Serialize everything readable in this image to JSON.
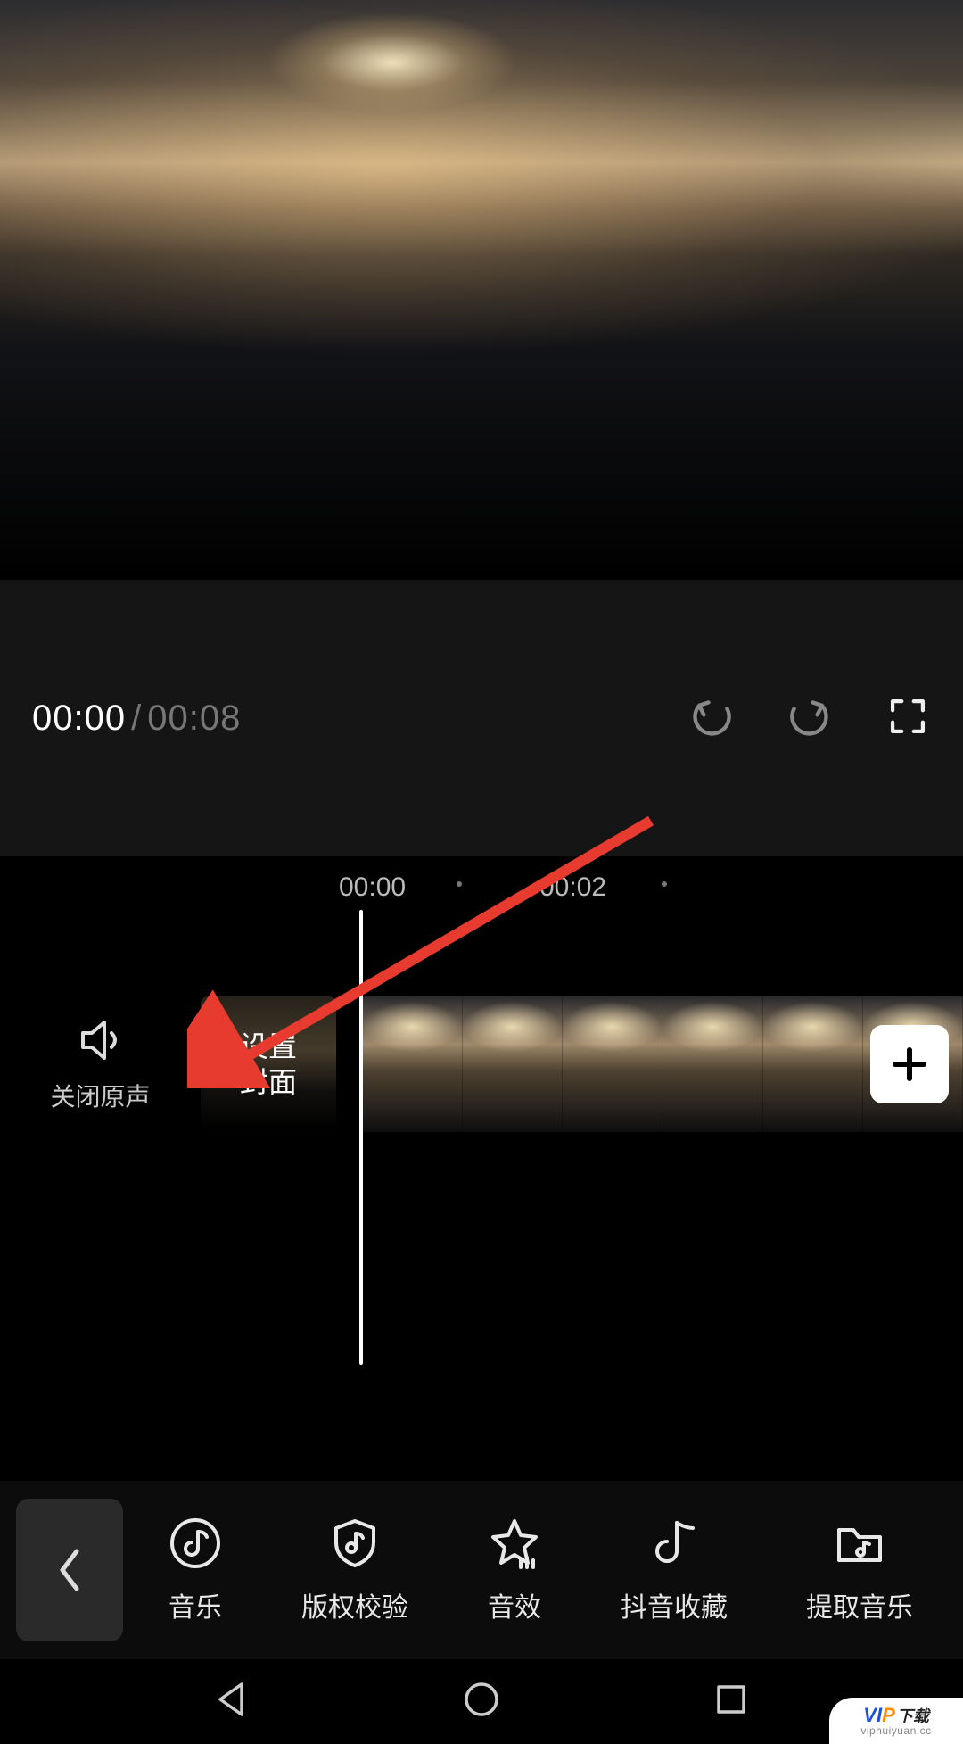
{
  "playback": {
    "current": "00:00",
    "separator": "/",
    "duration": "00:08"
  },
  "ruler": {
    "t0": "00:00",
    "t2": "00:02"
  },
  "mute_label": "关闭原声",
  "cover_label": "设置\n封面",
  "toolbar": {
    "items": [
      {
        "label": "音乐"
      },
      {
        "label": "版权校验"
      },
      {
        "label": "音效"
      },
      {
        "label": "抖音收藏"
      },
      {
        "label": "提取音乐"
      }
    ]
  },
  "watermark": {
    "brand_v": "V",
    "brand_i": "I",
    "brand_p": "P",
    "brand_dl": "下载",
    "site": "viphuiyuan.cc"
  }
}
